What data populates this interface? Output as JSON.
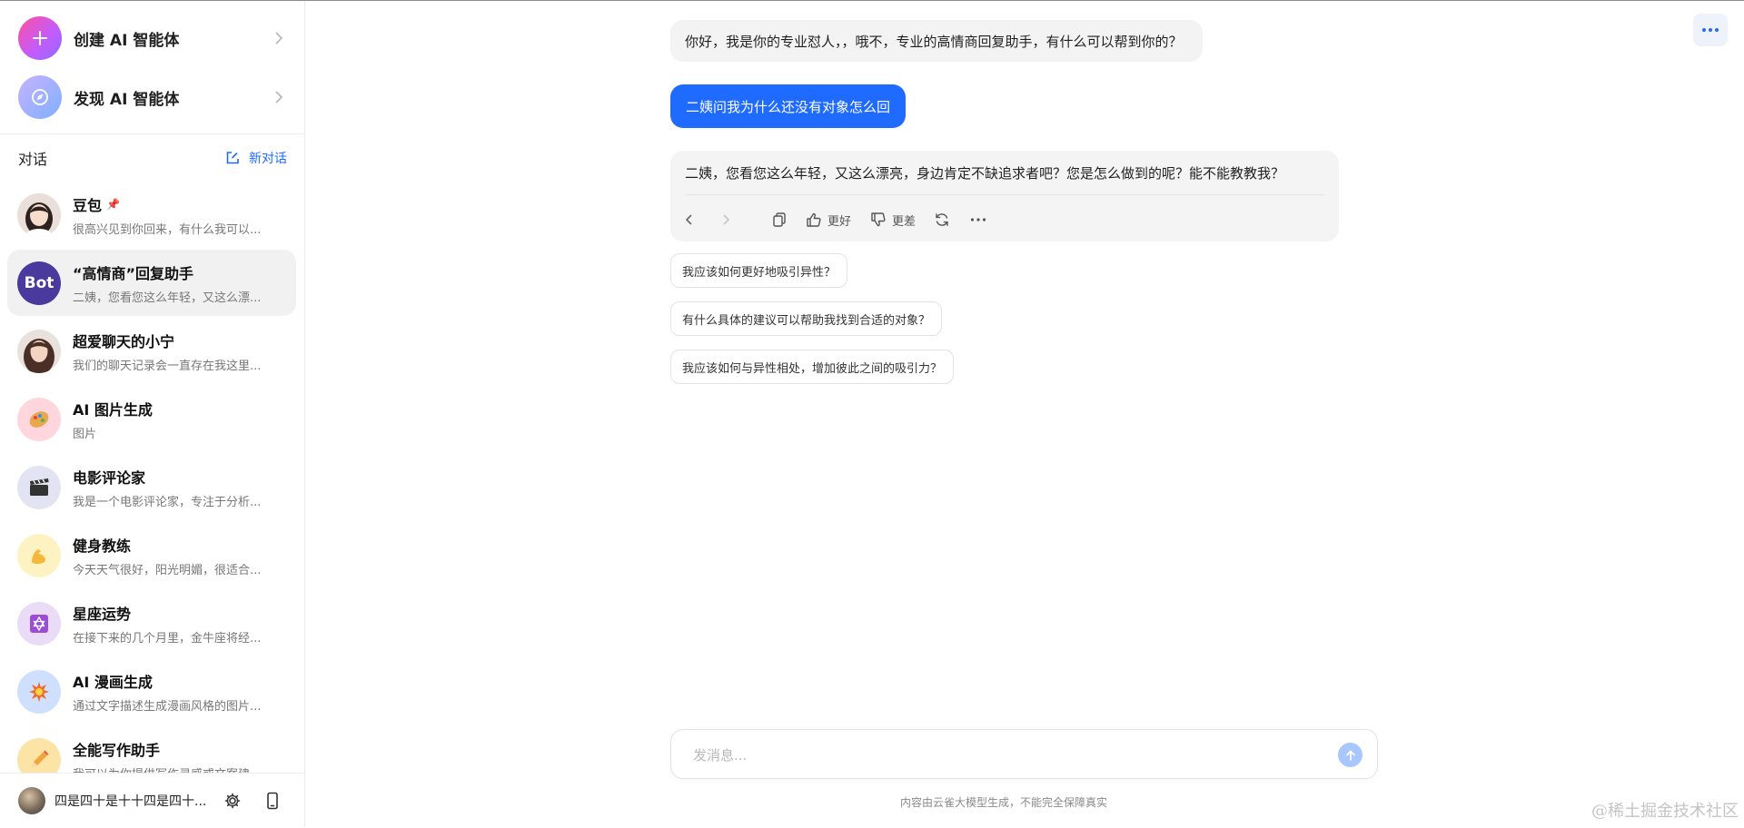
{
  "sidebar": {
    "create_label": "创建 AI 智能体",
    "discover_label": "发现 AI 智能体",
    "section_title": "对话",
    "new_chat_label": "新对话",
    "conversations": [
      {
        "title": "豆包",
        "subtitle": "很高兴见到你回来，有什么我可以..."
      },
      {
        "title": "“高情商”回复助手",
        "subtitle": "二姨，您看您这么年轻，又这么漂...",
        "avatar_text": "Bot"
      },
      {
        "title": "超爱聊天的小宁",
        "subtitle": "我们的聊天记录会一直存在我这里..."
      },
      {
        "title": "AI 图片生成",
        "subtitle": "图片"
      },
      {
        "title": "电影评论家",
        "subtitle": "我是一个电影评论家，专注于分析..."
      },
      {
        "title": "健身教练",
        "subtitle": "今天天气很好，阳光明媚，很适合..."
      },
      {
        "title": "星座运势",
        "subtitle": "在接下来的几个月里，金牛座将经..."
      },
      {
        "title": "AI 漫画生成",
        "subtitle": "通过文字描述生成漫画风格的图片..."
      },
      {
        "title": "全能写作助手",
        "subtitle": "我可以为你提供写作灵感或文案建..."
      }
    ],
    "user_name": "四是四十是十十四是四十..."
  },
  "chat": {
    "bot_greeting": "你好，我是你的专业怼人，，哦不，专业的高情商回复助手，有什么可以帮到你的？",
    "user_message": "二姨问我为什么还没有对象怎么回",
    "bot_reply": "二姨，您看您这么年轻，又这么漂亮，身边肯定不缺追求者吧？您是怎么做到的呢？能不能教教我？",
    "toolbar": {
      "better_label": "更好",
      "worse_label": "更差"
    },
    "suggestions": [
      "我应该如何更好地吸引异性？",
      "有什么具体的建议可以帮助我找到合适的对象？",
      "我应该如何与异性相处，增加彼此之间的吸引力？"
    ],
    "input_placeholder": "发消息...",
    "disclaimer": "内容由云雀大模型生成，不能完全保障真实"
  },
  "watermark": "@稀土掘金技术社区",
  "colors": {
    "accent": "#1f6bff",
    "bot_bubble": "#f3f3f3",
    "active_item": "#f1f1f2",
    "send_disabled": "#a9c7ff"
  }
}
